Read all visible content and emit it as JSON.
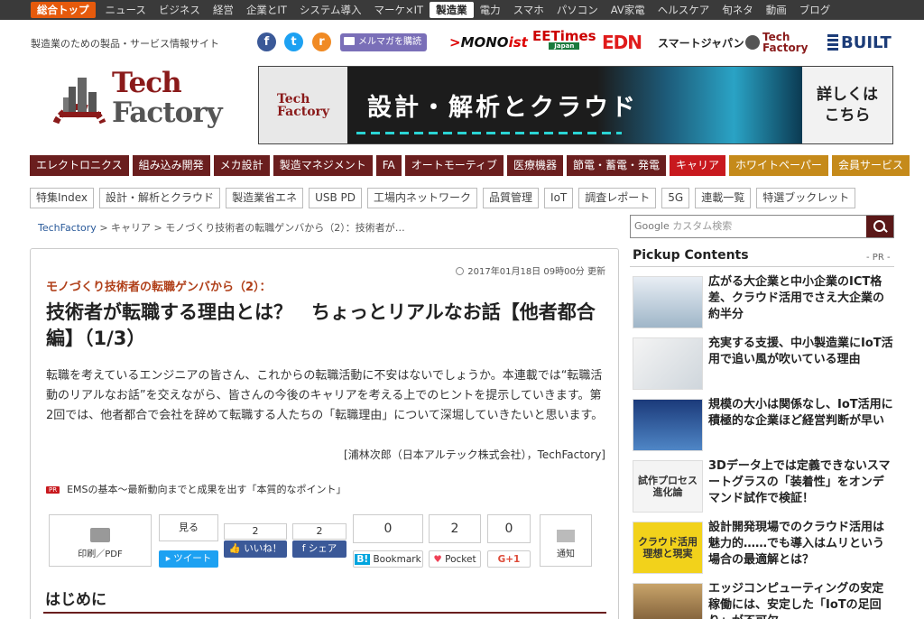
{
  "topnav": {
    "items": [
      "総合トップ",
      "ニュース",
      "ビジネス",
      "経営",
      "企業とIT",
      "システム導入",
      "マーケ×IT",
      "製造業",
      "電力",
      "スマホ",
      "パソコン",
      "AV家電",
      "ヘルスケア",
      "旬ネタ",
      "動画",
      "ブログ"
    ],
    "home_index": 0,
    "active_index": 7
  },
  "header": {
    "tagline": "製造業のための製品・サービス情報サイト",
    "social": {
      "facebook": "f",
      "twitter": "t",
      "rss": "r"
    },
    "mailmag_label": "メルマガを購読",
    "partners": {
      "mono_a": "MONO",
      "mono_b": "ist",
      "eetimes": "EETimes",
      "eetimes_sub": "Japan",
      "edn": "EDN",
      "smartjapan": "スマートジャパン",
      "techfactory_a": "Tech",
      "techfactory_b": "Factory",
      "built": "BUILT"
    }
  },
  "logo": {
    "line1": "Tech",
    "line2": "Factory"
  },
  "banner": {
    "left_a": "Tech",
    "left_b": "Factory",
    "main": "設計・解析とクラウド",
    "right_a": "詳しくは",
    "right_b": "こちら"
  },
  "category_nav": [
    {
      "label": "エレクトロニクス",
      "style": "dark"
    },
    {
      "label": "組み込み開発",
      "style": "dark"
    },
    {
      "label": "メカ設計",
      "style": "dark"
    },
    {
      "label": "製造マネジメント",
      "style": "dark"
    },
    {
      "label": "FA",
      "style": "dark"
    },
    {
      "label": "オートモーティブ",
      "style": "dark"
    },
    {
      "label": "医療機器",
      "style": "dark"
    },
    {
      "label": "節電・蓄電・発電",
      "style": "dark"
    },
    {
      "label": "キャリア",
      "style": "red"
    },
    {
      "label": "ホワイトペーパー",
      "style": "gold"
    },
    {
      "label": "会員サービス",
      "style": "gold"
    }
  ],
  "tags": [
    "特集Index",
    "設計・解析とクラウド",
    "製造業省エネ",
    "USB PD",
    "工場内ネットワーク",
    "品質管理",
    "IoT",
    "調査レポート",
    "5G",
    "連載一覧",
    "特選ブックレット"
  ],
  "breadcrumb": {
    "items": [
      "TechFactory",
      "キャリア",
      "モノづくり技術者の転職ゲンバから（2）：技術者が…"
    ],
    "sep": " > "
  },
  "article": {
    "date": "2017年01月18日 09時00分 更新",
    "series": "モノづくり技術者の転職ゲンバから（2）：",
    "title": "技術者が転職する理由とは？　ちょっとリアルなお話【他者都合編】（1/3）",
    "lead": "転職を考えているエンジニアの皆さん、これからの転職活動に不安はないでしょうか。本連載では“転職活動のリアルなお話”を交えながら、皆さんの今後のキャリアを考える上でのヒントを提示していきます。第2回では、他者都合で会社を辞めて転職する人たちの「転職理由」について深堀していきたいと思います。",
    "author": "[浦林次郎（日本アルテック株式会社），TechFactory]",
    "pr_badge": "PR",
    "pr_link": "EMSの基本〜最新動向までと成果を出す「本質的なポイント」",
    "section_heading": "はじめに"
  },
  "share": {
    "print_label": "印刷／PDF",
    "twitter_count_label": "見る",
    "twitter_label": "ツイート",
    "like_count": "2",
    "like_label": "いいね！",
    "fbshare_count": "2",
    "fbshare_label": "シェア",
    "hatena_count": "0",
    "hatena_label": "Bookmark",
    "hatena_icon": "B!",
    "pocket_count": "2",
    "pocket_label": "Pocket",
    "gplus_count": "0",
    "gplus_label": "G+1",
    "notify_label": "通知"
  },
  "sidebar": {
    "search_placeholder_brand": "Google",
    "search_placeholder": "カスタム検索",
    "pickup_title": "Pickup Contents",
    "pickup_pr": "- PR -",
    "pickup_items": [
      {
        "title": "広がる大企業と中小企業のICT格差、クラウド活用でさえ大企業の約半分",
        "thumb_text": ""
      },
      {
        "title": "充実する支援、中小製造業にIoT活用で追い風が吹いている理由",
        "thumb_text": ""
      },
      {
        "title": "規模の大小は関係なし、IoT活用に積極的な企業ほど経営判断が早い",
        "thumb_text": ""
      },
      {
        "title": "3Dデータ上では定義できないスマートグラスの「装着性」をオンデマンド試作で検証！",
        "thumb_text": "試作プロセス進化論"
      },
      {
        "title": "設計開発現場でのクラウド活用は魅力的……でも導入はムリという場合の最適解とは？",
        "thumb_text": "クラウド活用理想と現実"
      },
      {
        "title": "エッジコンピューティングの安定稼働には、安定した「IoTの足回り」が不可欠",
        "thumb_text": ""
      }
    ]
  },
  "colors": {
    "accent": "#6a1e1e",
    "home": "#e65a0c",
    "career": "#c8191e",
    "gold": "#c58a1a"
  }
}
